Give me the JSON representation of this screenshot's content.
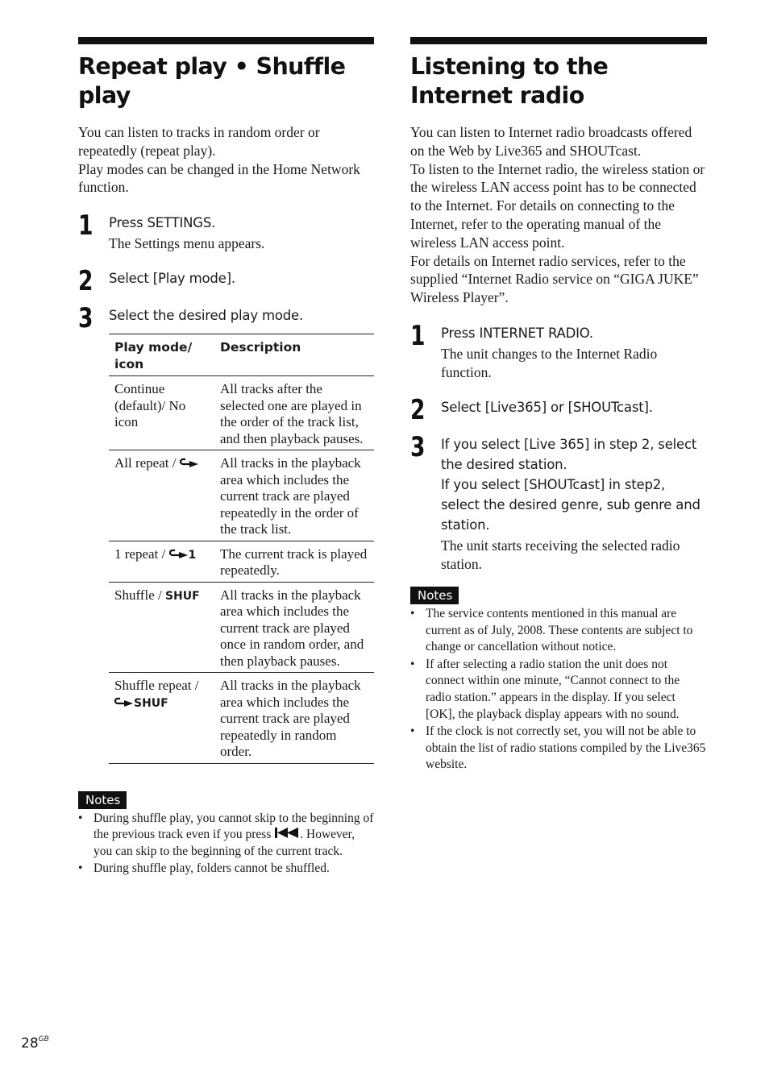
{
  "left": {
    "title": "Repeat play • Shuffle play",
    "intro": [
      "You can listen to tracks in random order or repeatedly (repeat play).",
      "Play modes can be changed in the Home Network function."
    ],
    "steps": [
      {
        "num": "1",
        "action": "Press SETTINGS.",
        "result": "The Settings menu appears."
      },
      {
        "num": "2",
        "action": "Select [Play mode].",
        "result": ""
      },
      {
        "num": "3",
        "action": "Select the desired play mode.",
        "result": ""
      }
    ],
    "table": {
      "headers": [
        "Play mode/ icon",
        "Description"
      ],
      "rows": [
        {
          "mode": "Continue (default)/ No icon",
          "icon_text": "",
          "icon": "none",
          "description": "All tracks after the selected one are played in the order of the track list, and then playback pauses."
        },
        {
          "mode": "All repeat / ",
          "icon_text": "",
          "icon": "repeat-icon",
          "description": "All tracks in the playback area which includes the current track are played repeatedly in the order of the track list."
        },
        {
          "mode": "1 repeat / ",
          "icon_text": "1",
          "icon": "repeat-one-icon",
          "description": "The current track is played repeatedly."
        },
        {
          "mode": "Shuffle / ",
          "icon_text": "SHUF",
          "icon": "shuffle-icon",
          "description": "All tracks in the playback area which includes the current track are played once in random order, and then playback pauses."
        },
        {
          "mode": "Shuffle repeat / ",
          "icon_text": "SHUF",
          "icon": "shuffle-repeat-icon",
          "description": "All tracks in the playback area which includes the current track are played repeatedly in random order."
        }
      ]
    },
    "notes_label": "Notes",
    "notes": [
      {
        "before": "During shuffle play, you cannot skip to the beginning of the previous track even if you press ",
        "icon": "previous-track-icon",
        "after": ". However, you can skip to the beginning of the current track."
      },
      {
        "before": "During shuffle play, folders cannot be shuffled.",
        "icon": "",
        "after": ""
      }
    ]
  },
  "right": {
    "title": "Listening to the Internet radio",
    "intro": [
      "You can listen to Internet radio broadcasts offered on the Web by Live365 and SHOUTcast.",
      "To listen to the Internet radio, the wireless station or the wireless LAN access point has to be connected to the Internet. For details on connecting to the Internet, refer to the operating manual of the wireless LAN access point.",
      "For details on Internet radio services, refer to the supplied “Internet Radio service on “GIGA JUKE” Wireless Player”."
    ],
    "steps": [
      {
        "num": "1",
        "action": "Press INTERNET RADIO.",
        "result": "The unit changes to the Internet Radio function."
      },
      {
        "num": "2",
        "action": "Select [Live365] or [SHOUTcast].",
        "result": ""
      },
      {
        "num": "3",
        "action": "If you select [Live 365] in step 2, select the desired station.",
        "action2": "If you select [SHOUTcast] in step2, select the desired genre, sub genre and station.",
        "result": "The unit starts receiving the selected radio station."
      }
    ],
    "notes_label": "Notes",
    "notes": [
      "The service contents mentioned in this manual are current as of July, 2008. These contents are subject to change or cancellation without notice.",
      "If after selecting a radio station the unit does not connect within one minute, “Cannot connect to the radio station.” appears in the display. If you select [OK], the playback display appears with no sound.",
      "If the clock is not correctly set, you will not be able to obtain the list of radio stations compiled by the Live365 website."
    ]
  },
  "footer": {
    "page_number": "28",
    "page_suffix": "GB"
  }
}
